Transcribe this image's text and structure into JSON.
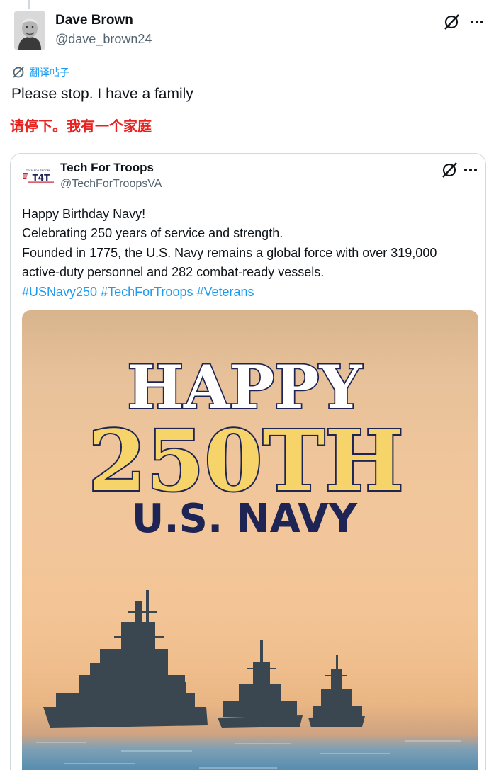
{
  "post": {
    "author_name": "Dave Brown",
    "author_handle": "@dave_brown24",
    "translate_label": "翻译帖子",
    "text": "Please stop. I have a family",
    "translated_text": "请停下。我有一个家庭"
  },
  "quoted_post": {
    "author_name": "Tech For Troops",
    "author_handle": "@TechForTroopsVA",
    "logo_top_text": "TECH FOR TROOPS",
    "logo_text": "T4T",
    "lines": [
      "Happy Birthday Navy!",
      "Celebrating 250 years of service and strength.",
      "Founded in 1775, the U.S. Navy remains a global force with over 319,000",
      "active-duty personnel and 282 combat-ready vessels."
    ],
    "hashtags": [
      "#USNavy250",
      "#TechForTroops",
      "#Veterans"
    ],
    "image": {
      "line1": "HAPPY",
      "line2": "250TH",
      "line3": "U.S. NAVY"
    }
  },
  "icons": {
    "grok": "grok-icon",
    "more": "more-icon",
    "translate": "translate-icon"
  },
  "colors": {
    "link": "#1d9bf0",
    "translation": "#e8231f",
    "headline_gold": "#f6d469",
    "headline_navy": "#1e2454"
  }
}
